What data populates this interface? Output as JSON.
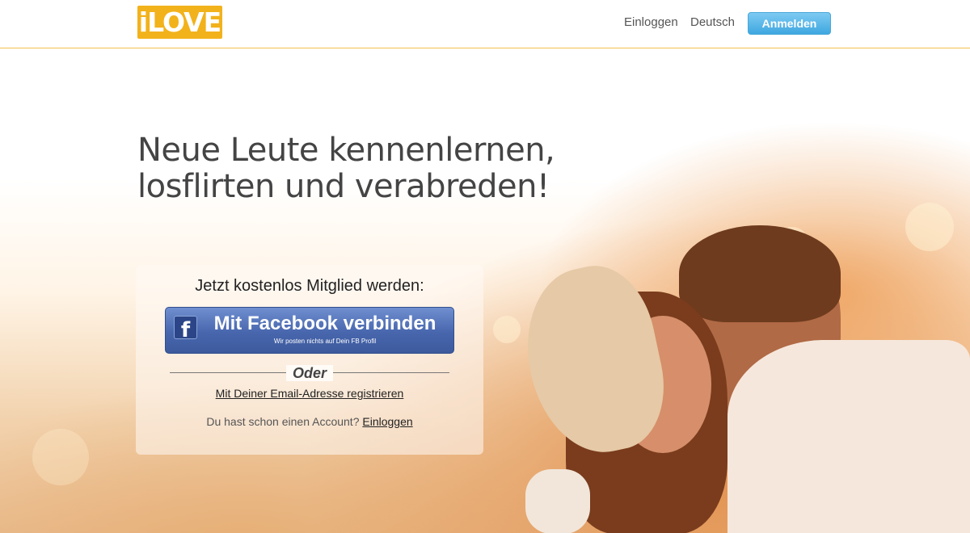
{
  "brand": {
    "logo": "iLOVE",
    "accent": "#f2b21b"
  },
  "nav": {
    "login": "Einloggen",
    "language": "Deutsch",
    "signup": "Anmelden"
  },
  "hero": {
    "headline_line1": "Neue Leute kennenlernen,",
    "headline_line2": "losflirten und verabreden!"
  },
  "signup": {
    "title": "Jetzt kostenlos Mitglied werden:",
    "facebook_button": "Mit Facebook verbinden",
    "facebook_subtext": "Wir posten nichts auf Dein FB Profil",
    "facebook_icon": "facebook-icon",
    "or": "Oder",
    "email_link": "Mit Deiner Email-Adresse registrieren",
    "account_prompt": "Du hast schon einen Account?",
    "account_login": "Einloggen"
  },
  "colors": {
    "facebook": "#3d5a9d",
    "signup_button": "#3fa8e0"
  }
}
